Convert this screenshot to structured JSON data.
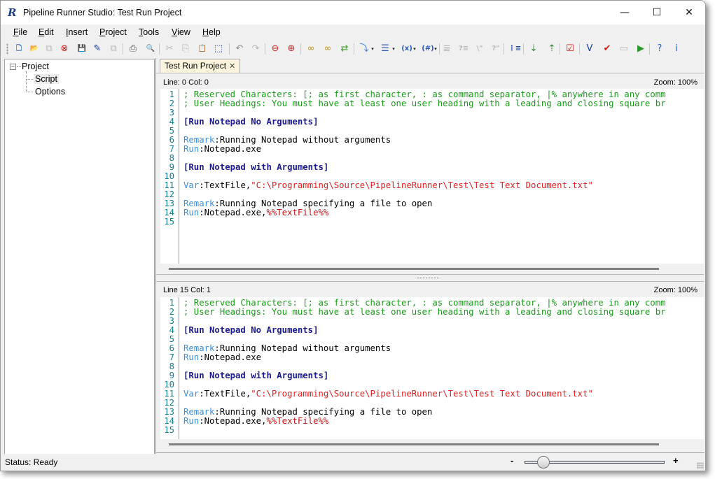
{
  "window": {
    "title": "Pipeline Runner Studio: Test Run Project",
    "app_icon_glyph": "R",
    "controls": {
      "minimize": "—",
      "maximize": "☐",
      "close": "✕"
    }
  },
  "menu": [
    {
      "label": "File",
      "ul": "F",
      "rest": "ile"
    },
    {
      "label": "Edit",
      "ul": "E",
      "rest": "dit"
    },
    {
      "label": "Insert",
      "ul": "I",
      "rest": "nsert"
    },
    {
      "label": "Project",
      "ul": "P",
      "rest": "roject"
    },
    {
      "label": "Tools",
      "ul": "T",
      "rest": "ools"
    },
    {
      "label": "View",
      "ul": "V",
      "rest": "iew"
    },
    {
      "label": "Help",
      "ul": "H",
      "rest": "elp"
    }
  ],
  "toolbar": [
    {
      "name": "new-file-icon",
      "glyph": "🗋",
      "color": "#3d6fb8",
      "enabled": true
    },
    {
      "name": "open-folder-icon",
      "glyph": "📂",
      "color": "#d8a020",
      "enabled": true
    },
    {
      "name": "close-file-icon",
      "glyph": "⧉",
      "color": "#b7b7b7",
      "enabled": false
    },
    {
      "name": "delete-file-icon",
      "glyph": "⊗",
      "color": "#d01818",
      "enabled": true
    },
    {
      "name": "save-icon",
      "glyph": "💾",
      "color": "#1a3f9f",
      "enabled": true
    },
    {
      "name": "save-as-icon",
      "glyph": "✎",
      "color": "#1a3f9f",
      "enabled": true
    },
    {
      "name": "save-all-icon",
      "glyph": "⧉",
      "color": "#b7b7b7",
      "enabled": false
    },
    {
      "name": "print-icon",
      "glyph": "⎙",
      "color": "#555555",
      "enabled": true
    },
    {
      "name": "print-preview-icon",
      "glyph": "🔍",
      "color": "#3d6fb8",
      "enabled": true
    },
    {
      "name": "cut-icon",
      "glyph": "✂",
      "color": "#b7b7b7",
      "enabled": false
    },
    {
      "name": "copy-icon",
      "glyph": "⎘",
      "color": "#b7b7b7",
      "enabled": false
    },
    {
      "name": "paste-icon",
      "glyph": "📋",
      "color": "#b7b7b7",
      "enabled": false
    },
    {
      "name": "select-all-icon",
      "glyph": "⬚",
      "color": "#1a3f9f",
      "enabled": true
    },
    {
      "name": "undo-icon",
      "glyph": "↶",
      "color": "#8a8a8a",
      "enabled": false
    },
    {
      "name": "redo-icon",
      "glyph": "↷",
      "color": "#b7b7b7",
      "enabled": false
    },
    {
      "name": "zoom-out-icon",
      "glyph": "⊖",
      "color": "#d02020",
      "enabled": true
    },
    {
      "name": "zoom-in-icon",
      "glyph": "⊕",
      "color": "#d02020",
      "enabled": true
    },
    {
      "name": "find-icon",
      "glyph": "∞",
      "color": "#c89010",
      "enabled": true
    },
    {
      "name": "find-next-icon",
      "glyph": "∞",
      "color": "#c89010",
      "enabled": true
    },
    {
      "name": "replace-icon",
      "glyph": "⇄",
      "color": "#3a9a20",
      "enabled": true
    },
    {
      "name": "insert-command-icon",
      "glyph": "⤵",
      "color": "#2a7ad8",
      "enabled": true,
      "dropdown": true
    },
    {
      "name": "insert-heading-icon",
      "glyph": "☰",
      "color": "#2a5ab8",
      "enabled": true,
      "dropdown": true
    },
    {
      "name": "insert-variable-icon",
      "glyph": "(x)",
      "color": "#2a5ab8",
      "enabled": true,
      "dropdown": true
    },
    {
      "name": "insert-number-icon",
      "glyph": "(#)",
      "color": "#2a5ab8",
      "enabled": true,
      "dropdown": true
    },
    {
      "name": "indent-icon",
      "glyph": "≣",
      "color": "#b7b7b7",
      "enabled": false
    },
    {
      "name": "comment-icon",
      "glyph": "?≡",
      "color": "#b7b7b7",
      "enabled": false
    },
    {
      "name": "quote-icon",
      "glyph": "\\\"",
      "color": "#b7b7b7",
      "enabled": false
    },
    {
      "name": "uncomment-icon",
      "glyph": "?\"",
      "color": "#b7b7b7",
      "enabled": false
    },
    {
      "name": "numbered-list-icon",
      "glyph": "⋮≡",
      "color": "#1a3f9f",
      "enabled": true
    },
    {
      "name": "import-icon",
      "glyph": "⇣",
      "color": "#2a8a2a",
      "enabled": true
    },
    {
      "name": "export-icon",
      "glyph": "⇡",
      "color": "#2a8a2a",
      "enabled": true
    },
    {
      "name": "validate-icon",
      "glyph": "☑",
      "color": "#d02020",
      "enabled": true
    },
    {
      "name": "variables-window-icon",
      "glyph": "V",
      "color": "#1a3f9f",
      "enabled": true
    },
    {
      "name": "debug-icon",
      "glyph": "✔",
      "color": "#d02020",
      "enabled": true
    },
    {
      "name": "terminal-icon",
      "glyph": "▭",
      "color": "#b7b7b7",
      "enabled": false
    },
    {
      "name": "run-icon",
      "glyph": "▶",
      "color": "#2a9a2a",
      "enabled": true
    },
    {
      "name": "help-icon",
      "glyph": "?",
      "color": "#1a5fd8",
      "enabled": true
    },
    {
      "name": "about-icon",
      "glyph": "i",
      "color": "#1a5fd8",
      "enabled": true
    }
  ],
  "tree": {
    "root": "Project",
    "root_toggle": "−",
    "children": [
      "Script",
      "Options"
    ],
    "selected": "Script"
  },
  "tab": {
    "label": "Test Run Project",
    "close": "✕"
  },
  "panes": [
    {
      "line_col": "Line: 0   Col: 0",
      "zoom": "Zoom: 100%"
    },
    {
      "line_col": "Line 15   Col: 1",
      "zoom": "Zoom: 100%"
    }
  ],
  "script_lines": [
    [
      {
        "t": "; Reserved Characters: [; as first character, : as command separator, |% anywhere in any comm",
        "c": "comment"
      }
    ],
    [
      {
        "t": "; User Headings: You must have at least one user heading with a leading and closing square br",
        "c": "comment"
      }
    ],
    [],
    [
      {
        "t": "[Run Notepad No Arguments]",
        "c": "heading"
      }
    ],
    [],
    [
      {
        "t": "Remark",
        "c": "key"
      },
      {
        "t": ":Running Notepad without arguments",
        "c": "text"
      }
    ],
    [
      {
        "t": "Run",
        "c": "key"
      },
      {
        "t": ":Notepad.exe",
        "c": "text"
      }
    ],
    [],
    [
      {
        "t": "[Run Notepad with Arguments]",
        "c": "heading"
      }
    ],
    [],
    [
      {
        "t": "Var",
        "c": "key"
      },
      {
        "t": ":TextFile,",
        "c": "text"
      },
      {
        "t": "\"C:\\Programming\\Source\\PipelineRunner\\Test\\Test Text Document.txt\"",
        "c": "str"
      }
    ],
    [],
    [
      {
        "t": "Remark",
        "c": "key"
      },
      {
        "t": ":Running Notepad specifying a file to open",
        "c": "text"
      }
    ],
    [
      {
        "t": "Run",
        "c": "key"
      },
      {
        "t": ":Notepad.exe,",
        "c": "text"
      },
      {
        "t": "%%TextFile%%",
        "c": "var"
      }
    ],
    []
  ],
  "status": {
    "text": "Status:  Ready"
  },
  "zoom_slider": {
    "minus": "-",
    "plus": "+",
    "value_fraction": 0.13
  }
}
